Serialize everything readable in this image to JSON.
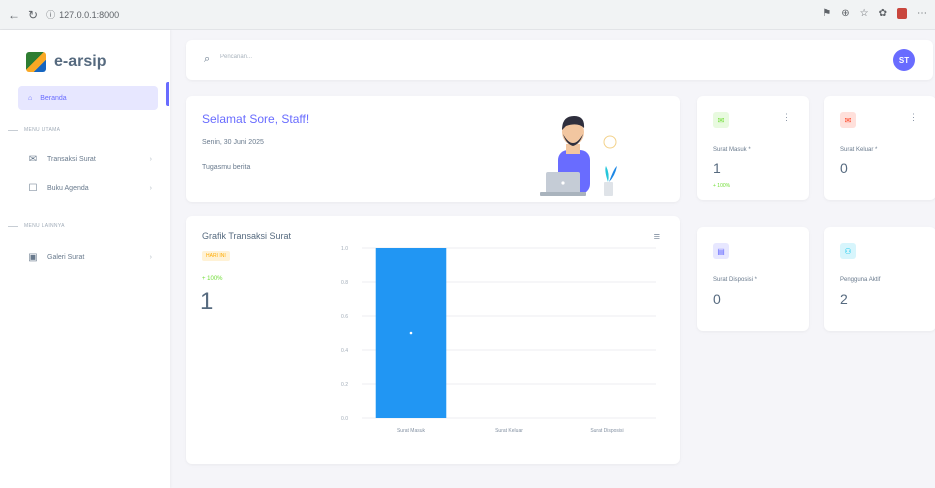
{
  "browser": {
    "back": "←",
    "reload": "↻",
    "url": "127.0.0.1:8000"
  },
  "sidebar": {
    "logo_text": "e-arsip",
    "active_item": "Beranda",
    "headers": [
      "MENU UTAMA",
      "MENU LAINNYA"
    ],
    "items": [
      {
        "label": "Transaksi Surat",
        "icon": "mail-icon"
      },
      {
        "label": "Buku Agenda",
        "icon": "book-icon"
      },
      {
        "label": "Galeri Surat",
        "icon": "image-icon"
      }
    ]
  },
  "topbar": {
    "search_placeholder": "Pencarian...",
    "avatar_initials": "ST"
  },
  "welcome": {
    "title": "Selamat Sore, Staff!",
    "date": "Senin, 30 Juni 2025",
    "message": "Tugasmu berita"
  },
  "chart_card": {
    "title": "Grafik Transaksi Surat",
    "badge": "HARI INI",
    "percent": "+ 100%",
    "value": "1"
  },
  "chart_data": {
    "type": "bar",
    "categories": [
      "Surat Masuk",
      "Surat Keluar",
      "Surat Disposisi"
    ],
    "values": [
      1,
      0,
      0
    ],
    "ylim": [
      0,
      1
    ],
    "yticks": [
      "0.0",
      "0.2",
      "0.4",
      "0.6",
      "0.8",
      "1.0"
    ],
    "color": "#2196f3",
    "grid": true
  },
  "stats": [
    {
      "label": "Surat Masuk *",
      "value": "1",
      "pct": "+ 100%",
      "icon": "inbox-icon",
      "color": "#71dd37",
      "bg": "#e8fadf"
    },
    {
      "label": "Surat Keluar *",
      "value": "0",
      "pct": "",
      "icon": "outbox-icon",
      "color": "#ff3e1d",
      "bg": "#ffe0db"
    },
    {
      "label": "Surat Disposisi *",
      "value": "0",
      "pct": "",
      "icon": "disposition-icon",
      "color": "#696cff",
      "bg": "#e7e7ff"
    },
    {
      "label": "Pengguna Aktif",
      "value": "2",
      "pct": "",
      "icon": "user-icon",
      "color": "#03c3ec",
      "bg": "#d7f5fc"
    }
  ]
}
